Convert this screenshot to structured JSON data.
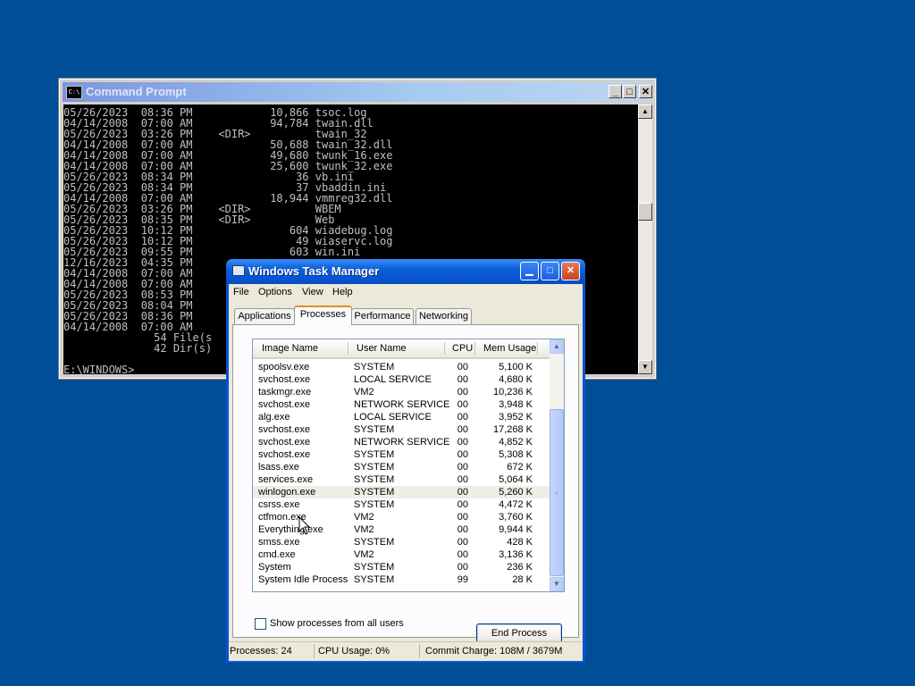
{
  "colors": {
    "desktop": "#004e98",
    "xp_titlebar": "#0653d0",
    "window_face": "#ece9d8",
    "console_bg": "#000000",
    "console_fg": "#c0c0c0"
  },
  "cmd": {
    "title": "Command Prompt",
    "icon": "console-icon",
    "lines": [
      "05/26/2023  08:36 PM            10,866 tsoc.log",
      "04/14/2008  07:00 AM            94,784 twain.dll",
      "05/26/2023  03:26 PM    <DIR>          twain_32",
      "04/14/2008  07:00 AM            50,688 twain_32.dll",
      "04/14/2008  07:00 AM            49,680 twunk_16.exe",
      "04/14/2008  07:00 AM            25,600 twunk_32.exe",
      "05/26/2023  08:34 PM                36 vb.ini",
      "05/26/2023  08:34 PM                37 vbaddin.ini",
      "04/14/2008  07:00 AM            18,944 vmmreg32.dll",
      "05/26/2023  03:26 PM    <DIR>          WBEM",
      "05/26/2023  08:35 PM    <DIR>          Web",
      "05/26/2023  10:12 PM               604 wiadebug.log",
      "05/26/2023  10:12 PM                49 wiaservc.log",
      "05/26/2023  09:55 PM               603 win.ini",
      "12/16/2023  04:35 PM",
      "04/14/2008  07:00 AM",
      "04/14/2008  07:00 AM",
      "05/26/2023  08:53 PM",
      "05/26/2023  08:04 PM",
      "05/26/2023  08:36 PM",
      "04/14/2008  07:00 AM",
      "              54 File(s",
      "              42 Dir(s)",
      "",
      "E:\\WINDOWS>"
    ]
  },
  "taskmgr": {
    "title": "Windows Task Manager",
    "menu": [
      "File",
      "Options",
      "View",
      "Help"
    ],
    "tabs": [
      "Applications",
      "Processes",
      "Performance",
      "Networking"
    ],
    "active_tab": "Processes",
    "columns": [
      "Image Name",
      "User Name",
      "CPU",
      "Mem Usage"
    ],
    "processes": [
      {
        "name": "spoolsv.exe",
        "user": "SYSTEM",
        "cpu": "00",
        "mem": "5,100 K"
      },
      {
        "name": "svchost.exe",
        "user": "LOCAL SERVICE",
        "cpu": "00",
        "mem": "4,680 K"
      },
      {
        "name": "taskmgr.exe",
        "user": "VM2",
        "cpu": "00",
        "mem": "10,236 K"
      },
      {
        "name": "svchost.exe",
        "user": "NETWORK SERVICE",
        "cpu": "00",
        "mem": "3,948 K"
      },
      {
        "name": "alg.exe",
        "user": "LOCAL SERVICE",
        "cpu": "00",
        "mem": "3,952 K"
      },
      {
        "name": "svchost.exe",
        "user": "SYSTEM",
        "cpu": "00",
        "mem": "17,268 K"
      },
      {
        "name": "svchost.exe",
        "user": "NETWORK SERVICE",
        "cpu": "00",
        "mem": "4,852 K"
      },
      {
        "name": "svchost.exe",
        "user": "SYSTEM",
        "cpu": "00",
        "mem": "5,308 K"
      },
      {
        "name": "lsass.exe",
        "user": "SYSTEM",
        "cpu": "00",
        "mem": "672 K"
      },
      {
        "name": "services.exe",
        "user": "SYSTEM",
        "cpu": "00",
        "mem": "5,064 K"
      },
      {
        "name": "winlogon.exe",
        "user": "SYSTEM",
        "cpu": "00",
        "mem": "5,260 K",
        "selected": true
      },
      {
        "name": "csrss.exe",
        "user": "SYSTEM",
        "cpu": "00",
        "mem": "4,472 K"
      },
      {
        "name": "ctfmon.exe",
        "user": "VM2",
        "cpu": "00",
        "mem": "3,760 K"
      },
      {
        "name": "Everything.exe",
        "user": "VM2",
        "cpu": "00",
        "mem": "9,944 K"
      },
      {
        "name": "smss.exe",
        "user": "SYSTEM",
        "cpu": "00",
        "mem": "428 K"
      },
      {
        "name": "cmd.exe",
        "user": "VM2",
        "cpu": "00",
        "mem": "3,136 K"
      },
      {
        "name": "System",
        "user": "SYSTEM",
        "cpu": "00",
        "mem": "236 K"
      },
      {
        "name": "System Idle Process",
        "user": "SYSTEM",
        "cpu": "99",
        "mem": "28 K"
      }
    ],
    "show_all_users_label": "Show processes from all users",
    "show_all_users_checked": false,
    "end_process_label": "End Process",
    "status": {
      "processes": "Processes: 24",
      "cpu": "CPU Usage: 0%",
      "commit": "Commit Charge: 108M / 3679M"
    }
  }
}
